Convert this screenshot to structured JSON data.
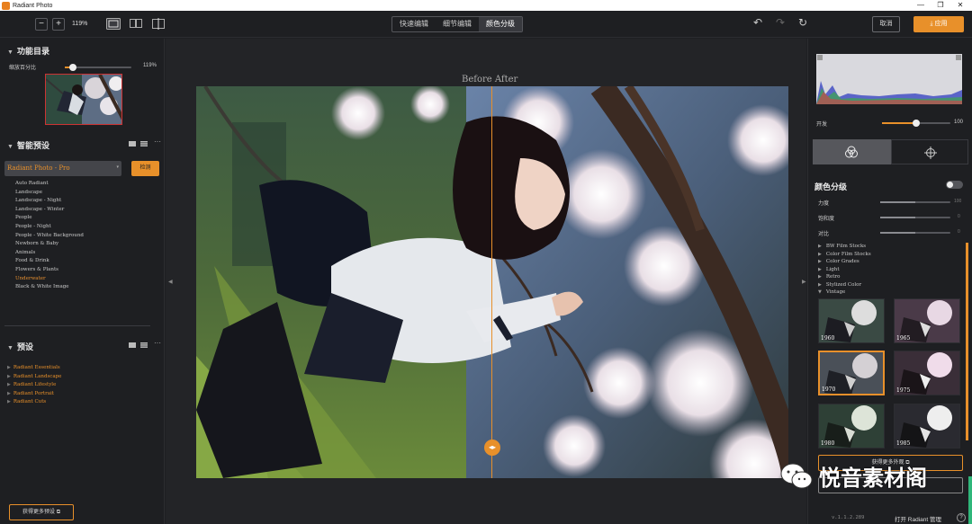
{
  "app": {
    "title": "Radiant Photo"
  },
  "window_controls": {
    "minimize": "—",
    "maximize": "❐",
    "close": "✕"
  },
  "toolbar": {
    "zoom_out": "−",
    "zoom_in": "+",
    "zoom_level": "119%",
    "tabs": [
      {
        "label": "快速编辑"
      },
      {
        "label": "细节编辑"
      },
      {
        "label": "颜色分级"
      }
    ],
    "undo": "↶",
    "redo": "↷",
    "reset": "↻",
    "cancel_label": "取消",
    "apply_label": "应用",
    "apply_icon": "⤓"
  },
  "left": {
    "catalog_title": "功能目录",
    "zoom_label": "缩放百分比",
    "zoom_value": "119%",
    "zoom_fraction": 0.12,
    "smart_presets_title": "智能预设",
    "preset_select": "Radiant Photo - Pro",
    "detect_label": "检测",
    "presets": [
      {
        "label": "Auto Radiant"
      },
      {
        "label": "Landscape"
      },
      {
        "label": "Landscape - Night"
      },
      {
        "label": "Landscape - Winter"
      },
      {
        "label": "People"
      },
      {
        "label": "People - Night"
      },
      {
        "label": "People - White Background"
      },
      {
        "label": "Newborn & Baby"
      },
      {
        "label": "Animals"
      },
      {
        "label": "Food & Drink"
      },
      {
        "label": "Flowers & Plants"
      },
      {
        "label": "Underwater"
      },
      {
        "label": "Black & White Image"
      }
    ],
    "presets_title": "预设",
    "preset_groups": [
      {
        "label": "Radiant Essentials"
      },
      {
        "label": "Radiant Landscape"
      },
      {
        "label": "Radiant Lifestyle"
      },
      {
        "label": "Radiant Portrait"
      },
      {
        "label": "Radiant Cuts"
      }
    ],
    "more_presets_label": "获得更多预设"
  },
  "center": {
    "compare_label": "Before After"
  },
  "right": {
    "opacity_label": "开发",
    "opacity_value": "100",
    "opacity_fraction": 0.5,
    "color_grading_title": "颜色分级",
    "sliders": [
      {
        "label": "力度",
        "value": "100",
        "fraction": 0.5
      },
      {
        "label": "饱和度",
        "value": "0",
        "fraction": 0.5
      },
      {
        "label": "对比",
        "value": "0",
        "fraction": 0.5
      }
    ],
    "categories": [
      {
        "label": "BW Film Stocks",
        "tri": "▶"
      },
      {
        "label": "Color Film Stocks",
        "tri": "▶"
      },
      {
        "label": "Color Grades",
        "tri": "▶"
      },
      {
        "label": "Light",
        "tri": "▶"
      },
      {
        "label": "Retro",
        "tri": "▶"
      },
      {
        "label": "Stylized Color",
        "tri": "▶"
      },
      {
        "label": "Vintage",
        "tri": "▼"
      }
    ],
    "thumbs": [
      {
        "label": "1960"
      },
      {
        "label": "1965"
      },
      {
        "label": "1970"
      },
      {
        "label": "1975"
      },
      {
        "label": "1980"
      },
      {
        "label": "1985"
      }
    ],
    "more_looks_label": "获得更多外观",
    "version": "v.1.1.2.289",
    "manage_label": "打开 Radiant 管理",
    "help_label": "?"
  },
  "watermark": {
    "text": "悦音素材阁"
  },
  "colors": {
    "accent": "#e8902a",
    "panel": "#1e1f22",
    "canvas": "#232427"
  }
}
